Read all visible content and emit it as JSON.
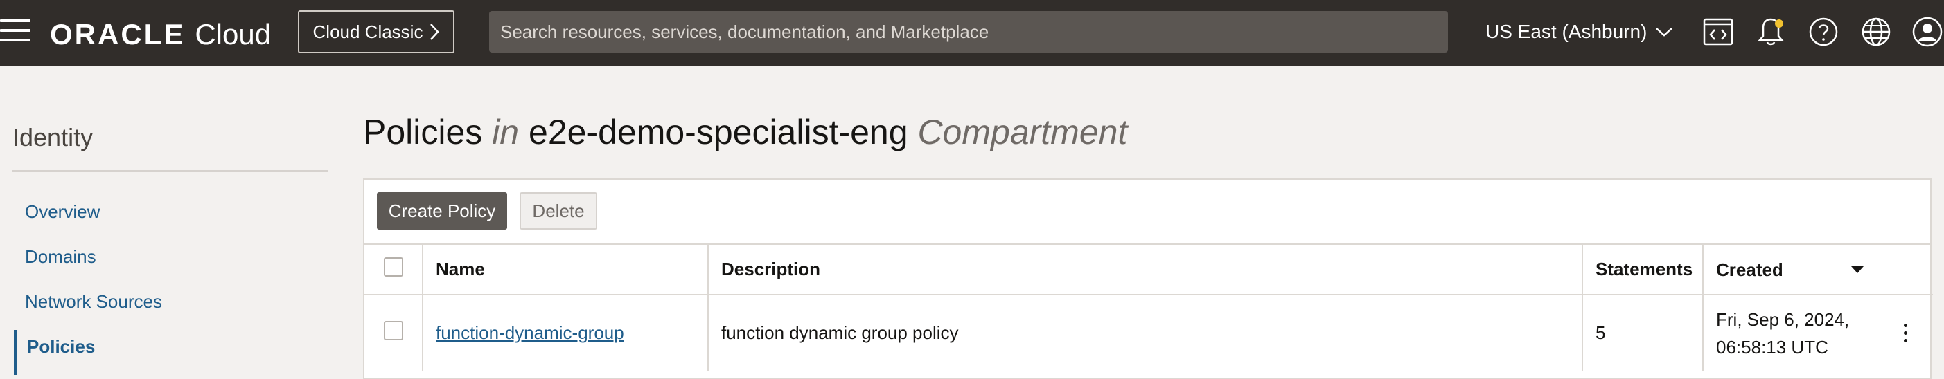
{
  "header": {
    "brand_oracle": "ORACLE",
    "brand_cloud": "Cloud",
    "classic_label": "Cloud Classic",
    "search_placeholder": "Search resources, services, documentation, and Marketplace",
    "region": "US East (Ashburn)",
    "icons": [
      "developer-tools-icon",
      "bell-icon",
      "help-icon",
      "globe-icon",
      "profile-icon"
    ]
  },
  "sidebar": {
    "title": "Identity",
    "items": [
      {
        "label": "Overview",
        "active": false
      },
      {
        "label": "Domains",
        "active": false
      },
      {
        "label": "Network Sources",
        "active": false
      },
      {
        "label": "Policies",
        "active": true
      }
    ]
  },
  "main": {
    "title_prefix": "Policies",
    "title_in": "in",
    "title_compartment_name": "e2e-demo-specialist-eng",
    "title_suffix": "Compartment",
    "create_label": "Create Policy",
    "delete_label": "Delete",
    "columns": {
      "name": "Name",
      "description": "Description",
      "statements": "Statements",
      "created": "Created"
    },
    "rows": [
      {
        "name": "function-dynamic-group",
        "description": "function dynamic group policy",
        "statements": "5",
        "created_line1": "Fri, Sep 6, 2024,",
        "created_line2": "06:58:13 UTC"
      }
    ]
  },
  "colors": {
    "topbar": "#312d2a",
    "link": "#1f5d8b",
    "primary_button": "#5d5955"
  }
}
